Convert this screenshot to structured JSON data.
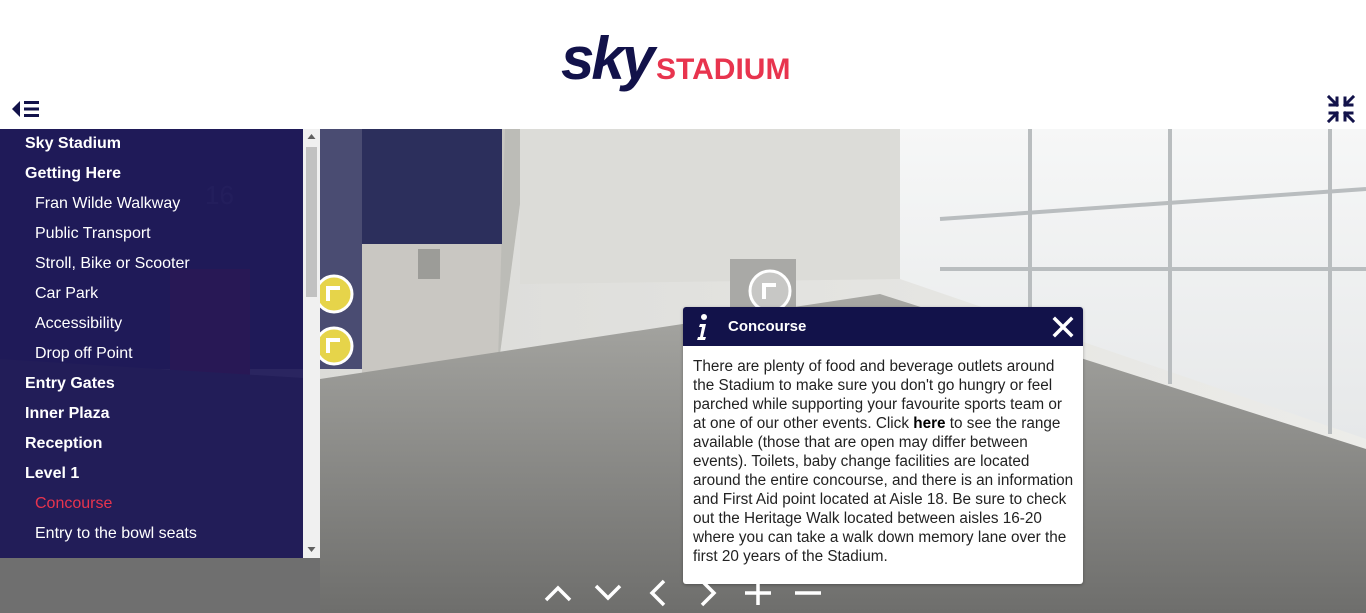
{
  "logo": {
    "word1": "sky",
    "word2": "STADIUM"
  },
  "sidebar": {
    "items": [
      {
        "label": "Sky Stadium",
        "level": 0,
        "active": false
      },
      {
        "label": "Getting Here",
        "level": 0,
        "active": false
      },
      {
        "label": "Fran Wilde Walkway",
        "level": 1,
        "active": false
      },
      {
        "label": "Public Transport",
        "level": 1,
        "active": false
      },
      {
        "label": "Stroll, Bike or Scooter",
        "level": 1,
        "active": false
      },
      {
        "label": "Car Park",
        "level": 1,
        "active": false
      },
      {
        "label": "Accessibility",
        "level": 1,
        "active": false
      },
      {
        "label": "Drop off Point",
        "level": 1,
        "active": false
      },
      {
        "label": "Entry Gates",
        "level": 0,
        "active": false
      },
      {
        "label": "Inner Plaza",
        "level": 0,
        "active": false
      },
      {
        "label": "Reception",
        "level": 0,
        "active": false
      },
      {
        "label": "Level 1",
        "level": 0,
        "active": false
      },
      {
        "label": "Concourse",
        "level": 1,
        "active": true
      },
      {
        "label": "Entry to the bowl seats",
        "level": 1,
        "active": false
      }
    ]
  },
  "info": {
    "title": "Concourse",
    "body_before": "There are plenty of food and beverage outlets around the Stadium to make sure you don't go hungry or feel parched while supporting your favourite sports team or at one of our other events. Click ",
    "link": "here",
    "body_after": " to see the range available (those that are open may differ between events). Toilets, baby change facilities are located around the entire concourse, and there is an information and First Aid point located at Aisle 18. Be sure to check out the Heritage Walk located between aisles 16-20 where you can take a walk down memory lane over the first 20 years of the Stadium."
  },
  "scene": {
    "sign_number": "16"
  },
  "icons": {
    "menu": "menu-collapse-icon",
    "fullscreen": "exit-fullscreen-icon",
    "info": "info-icon",
    "close": "close-icon",
    "hotspot": "hotspot-arrow-icon",
    "nav": [
      "chevron-up-icon",
      "chevron-down-icon",
      "chevron-left-icon",
      "chevron-right-icon",
      "plus-icon",
      "minus-icon"
    ]
  },
  "colors": {
    "navy": "#12124a",
    "sidebar": "#1b1656",
    "accent_red": "#e8344e",
    "logo_red": "#e8344e"
  }
}
